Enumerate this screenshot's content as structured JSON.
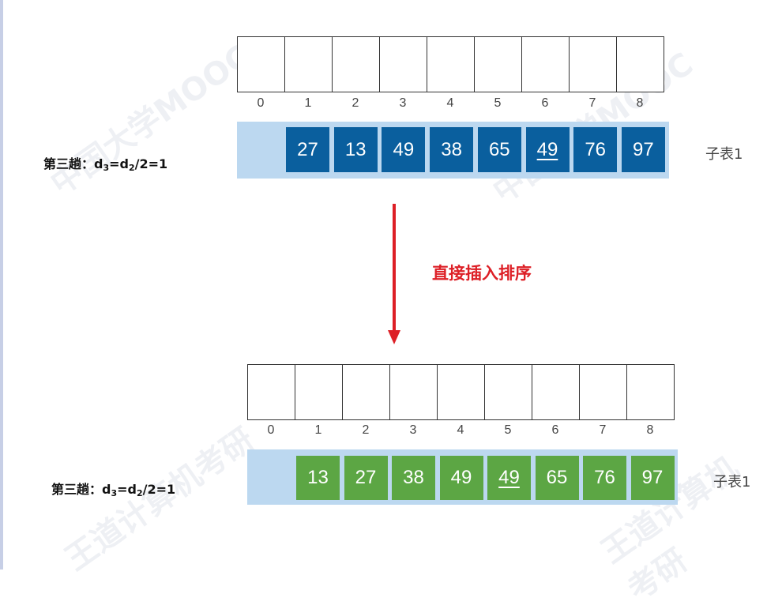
{
  "colors": {
    "top_tile": "#0a5f9e",
    "bottom_tile": "#5ca644",
    "band": "#bcd8f0",
    "arrow": "#dd1f26"
  },
  "top": {
    "indices": [
      "0",
      "1",
      "2",
      "3",
      "4",
      "5",
      "6",
      "7",
      "8"
    ],
    "tiles": [
      {
        "value": "27",
        "underlined": false
      },
      {
        "value": "13",
        "underlined": false
      },
      {
        "value": "49",
        "underlined": false
      },
      {
        "value": "38",
        "underlined": false
      },
      {
        "value": "65",
        "underlined": false
      },
      {
        "value": "49",
        "underlined": true
      },
      {
        "value": "76",
        "underlined": false
      },
      {
        "value": "97",
        "underlined": false
      }
    ],
    "label_left_prefix": "第三趟：",
    "label_left_d3": "d",
    "label_left_sub3": "3",
    "label_left_eq": "=d",
    "label_left_sub2": "2",
    "label_left_tail": "/2=1",
    "label_right": "子表1"
  },
  "operation": "直接插入排序",
  "bottom": {
    "indices": [
      "0",
      "1",
      "2",
      "3",
      "4",
      "5",
      "6",
      "7",
      "8"
    ],
    "tiles": [
      {
        "value": "13",
        "underlined": false
      },
      {
        "value": "27",
        "underlined": false
      },
      {
        "value": "38",
        "underlined": false
      },
      {
        "value": "49",
        "underlined": false
      },
      {
        "value": "49",
        "underlined": true
      },
      {
        "value": "65",
        "underlined": false
      },
      {
        "value": "76",
        "underlined": false
      },
      {
        "value": "97",
        "underlined": false
      }
    ],
    "label_left_prefix": "第三趟：",
    "label_left_d3": "d",
    "label_left_sub3": "3",
    "label_left_eq": "=d",
    "label_left_sub2": "2",
    "label_left_tail": "/2=1",
    "label_right": "子表1"
  }
}
